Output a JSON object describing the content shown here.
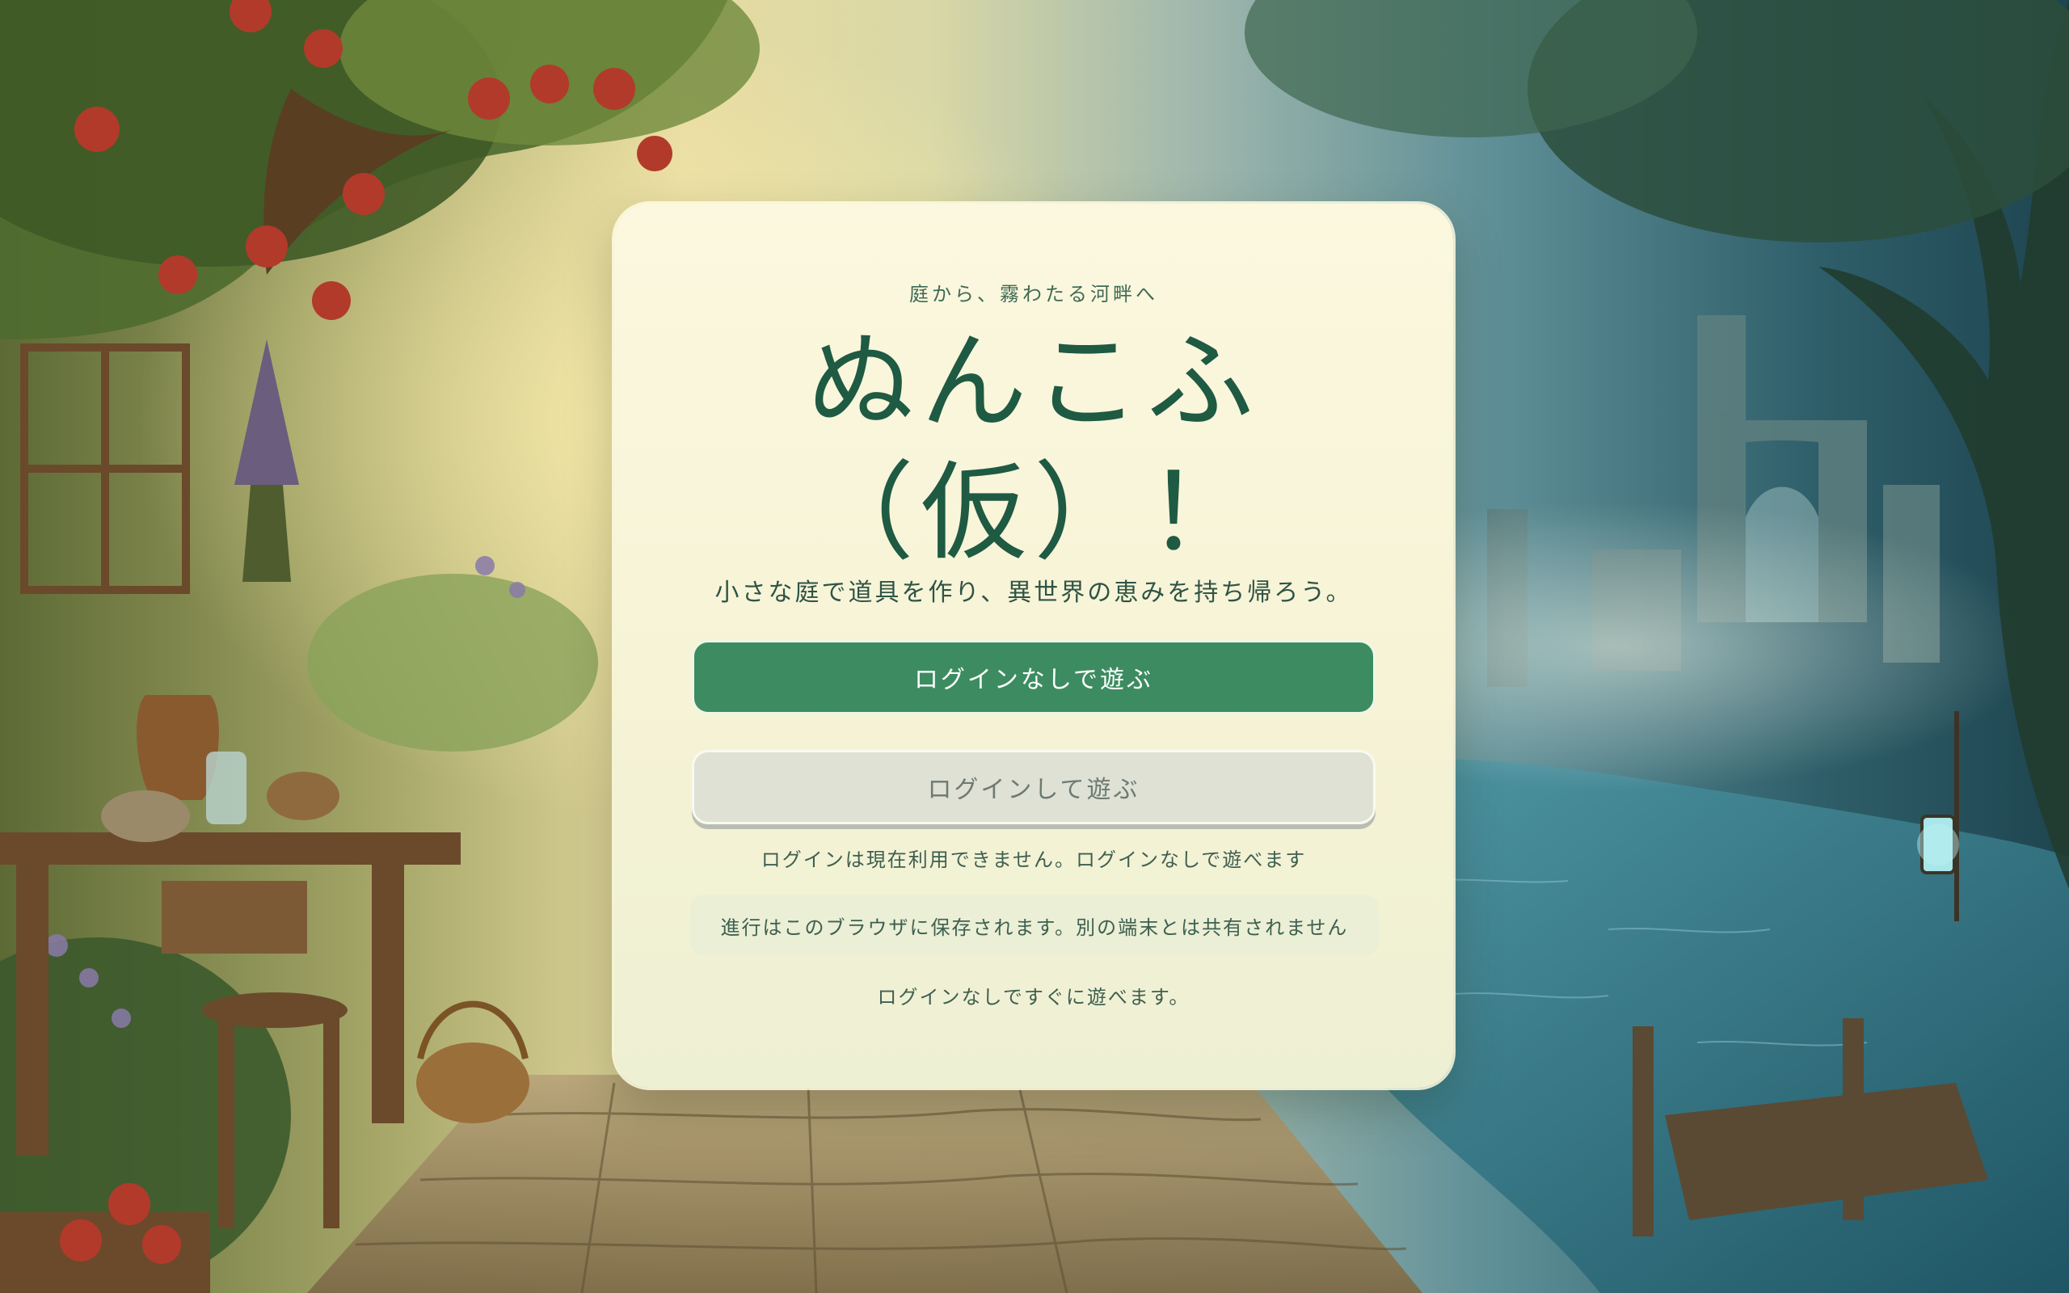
{
  "card": {
    "eyebrow": "庭から、霧わたる河畔へ",
    "title_line1": "ぬんこふ",
    "title_line2": "（仮）！",
    "lead": "小さな庭で道具を作り、異世界の恵みを持ち帰ろう。",
    "play_without_login_label": "ログインなしで遊ぶ",
    "play_with_login_label": "ログインして遊ぶ",
    "login_unavailable_note": "ログインは現在利用できません。ログインなしで遊べます",
    "save_notice": "進行はこのブラウザに保存されます。別の端末とは共有されません",
    "quick_play_note": "ログインなしですぐに遊べます。"
  },
  "colors": {
    "primary_button": "#3d8c61",
    "title": "#1f5a43",
    "card_background": "#fbf8df",
    "disabled_button": "#dee1d4"
  }
}
